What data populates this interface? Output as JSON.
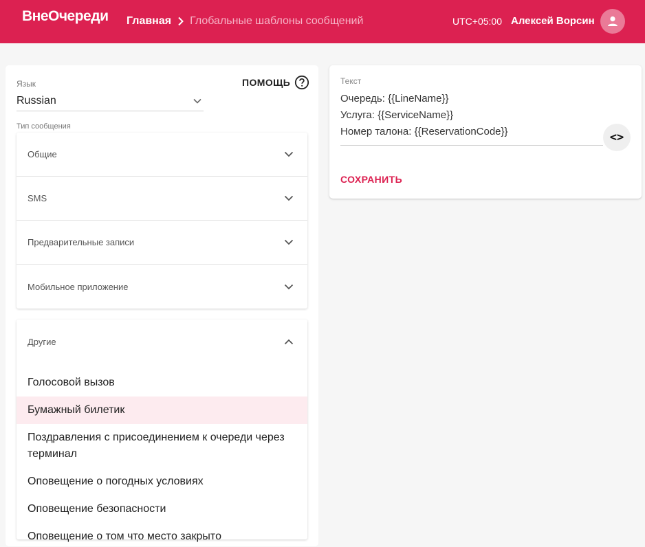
{
  "header": {
    "logo": "ВнеОчереди",
    "breadcrumb_home": "Главная",
    "breadcrumb_current": "Глобальные шаблоны сообщений",
    "timezone": "UTC+05:00",
    "user_name": "Алексей Ворсин",
    "brand_color": "#dc2151"
  },
  "left_panel": {
    "language_label": "Язык",
    "language_value": "Russian",
    "help_label": "ПОМОЩЬ",
    "message_type_label": "Тип сообщения",
    "accordion": [
      {
        "label": "Общие",
        "expanded": false
      },
      {
        "label": "SMS",
        "expanded": false
      },
      {
        "label": "Предварительные записи",
        "expanded": false
      },
      {
        "label": "Мобильное приложение",
        "expanded": false
      }
    ],
    "open_section": {
      "label": "Другие",
      "expanded": true,
      "items": [
        {
          "label": "Голосовой вызов",
          "selected": false
        },
        {
          "label": "Бумажный билетик",
          "selected": true
        },
        {
          "label": "Поздравления с присоединением к очереди через терминал",
          "selected": false
        },
        {
          "label": "Оповещение о погодных условиях",
          "selected": false
        },
        {
          "label": "Оповещение безопасности",
          "selected": false
        },
        {
          "label": "Оповещение о том что место закрыто",
          "selected": false
        }
      ]
    }
  },
  "right_panel": {
    "text_label": "Текст",
    "text_lines": [
      "Очередь: {{LineName}}",
      "Услуга: {{ServiceName}}",
      "Номер талона: {{ReservationCode}}"
    ],
    "code_toggle_label": "<>",
    "save_label": "СОХРАНИТЬ"
  }
}
